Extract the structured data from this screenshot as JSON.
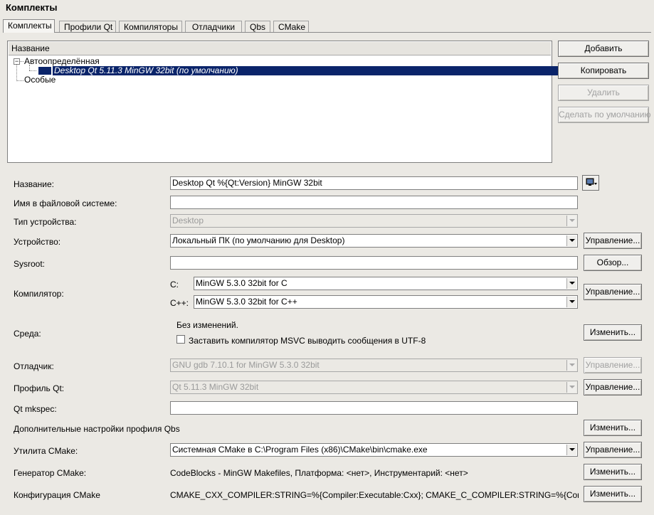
{
  "window": {
    "title": "Комплекты"
  },
  "tabs": [
    {
      "label": "Комплекты",
      "active": true
    },
    {
      "label": "Профили Qt"
    },
    {
      "label": "Компиляторы"
    },
    {
      "label": "Отладчики"
    },
    {
      "label": "Qbs"
    },
    {
      "label": "CMake"
    }
  ],
  "tree": {
    "header": "Название",
    "group_auto": "Автоопределённая",
    "selected_item": "Desktop Qt 5.11.3 MinGW 32bit (по умолчанию)",
    "group_manual": "Особые"
  },
  "side_buttons": {
    "add": "Добавить",
    "copy": "Копировать",
    "remove": "Удалить",
    "make_default": "Сделать по умолчанию"
  },
  "form": {
    "name": {
      "label": "Название:",
      "value": "Desktop Qt %{Qt:Version} MinGW 32bit"
    },
    "fs_name": {
      "label": "Имя в файловой системе:",
      "value": ""
    },
    "device_type": {
      "label": "Тип устройства:",
      "value": "Desktop"
    },
    "device": {
      "label": "Устройство:",
      "value": "Локальный ПК (по умолчанию для Desktop)",
      "button": "Управление..."
    },
    "sysroot": {
      "label": "Sysroot:",
      "value": "",
      "button": "Обзор..."
    },
    "compiler": {
      "label": "Компилятор:",
      "c_label": "C:",
      "c_value": "MinGW 5.3.0 32bit for C",
      "cpp_label": "C++:",
      "cpp_value": "MinGW 5.3.0 32bit for C++",
      "button": "Управление..."
    },
    "environment": {
      "label": "Среда:",
      "status": "Без изменений.",
      "checkbox_label": "Заставить компилятор MSVC выводить сообщения в UTF-8",
      "checked": false,
      "button": "Изменить..."
    },
    "debugger": {
      "label": "Отладчик:",
      "value": "GNU gdb 7.10.1 for MinGW 5.3.0 32bit",
      "button": "Управление..."
    },
    "qt_profile": {
      "label": "Профиль Qt:",
      "value": "Qt 5.11.3 MinGW 32bit",
      "button": "Управление..."
    },
    "qt_mkspec": {
      "label": "Qt mkspec:",
      "value": ""
    },
    "qbs_settings": {
      "label": "Дополнительные настройки профиля Qbs",
      "button": "Изменить..."
    },
    "cmake_tool": {
      "label": "Утилита CMake:",
      "value": "Системная CMake в C:\\Program Files (x86)\\CMake\\bin\\cmake.exe",
      "button": "Управление..."
    },
    "cmake_generator": {
      "label": "Генератор CMake:",
      "value": "CodeBlocks - MinGW Makefiles, Платформа: <нет>, Инструментарий: <нет>",
      "button": "Изменить..."
    },
    "cmake_config": {
      "label": "Конфигурация CMake",
      "value": "CMAKE_CXX_COMPILER:STRING=%{Compiler:Executable:Cxx}; CMAKE_C_COMPILER:STRING=%{Compiler:Execut...",
      "button": "Изменить..."
    }
  }
}
